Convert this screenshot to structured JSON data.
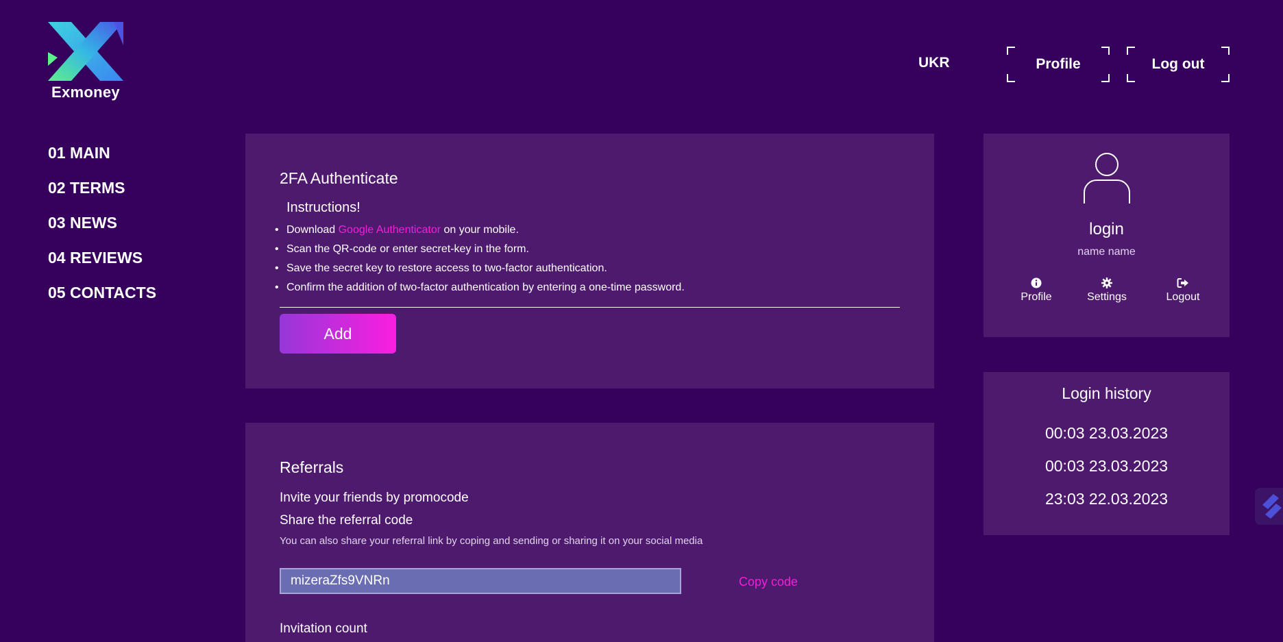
{
  "brand": {
    "name": "Exmoney"
  },
  "header": {
    "lang": "UKR",
    "profile_label": "Profile",
    "logout_label": "Log out"
  },
  "sidebar": {
    "items": [
      {
        "label": "01 MAIN"
      },
      {
        "label": "02 TERMS"
      },
      {
        "label": "03 NEWS"
      },
      {
        "label": "04 REVIEWS"
      },
      {
        "label": "05 CONTACTS"
      }
    ]
  },
  "twofa": {
    "title": "2FA Authenticate",
    "instructions_title": "Instructions!",
    "step1_pre": "Download ",
    "step1_link": "Google Authenticator",
    "step1_post": " on your mobile.",
    "step2": "Scan the QR-code or enter secret-key in the form.",
    "step3": "Save the secret key to restore access to two-factor authentication.",
    "step4": "Confirm the addition of two-factor authentication by entering a one-time password.",
    "add_label": "Add"
  },
  "referrals": {
    "title": "Referrals",
    "invite": "Invite your friends by promocode",
    "share": "Share the referral code",
    "note": "You can also share your referral link by coping and sending or sharing it on your social media",
    "code": "mizeraZfs9VNRn",
    "copy_label": "Copy code",
    "next_heading_partial": "Invitation count"
  },
  "profile_card": {
    "login": "login",
    "name": "name name",
    "actions": [
      {
        "label": "Profile",
        "icon": "info-icon"
      },
      {
        "label": "Settings",
        "icon": "gear-icon"
      },
      {
        "label": "Logout",
        "icon": "sign-out-icon"
      }
    ]
  },
  "login_history": {
    "title": "Login history",
    "entries": [
      "00:03 23.03.2023",
      "00:03 23.03.2023",
      "23:03 22.03.2023"
    ]
  },
  "colors": {
    "background": "#36005d",
    "panel": "#4e1a6e",
    "accent": "#f21fd9",
    "input": "#6a6db1"
  }
}
